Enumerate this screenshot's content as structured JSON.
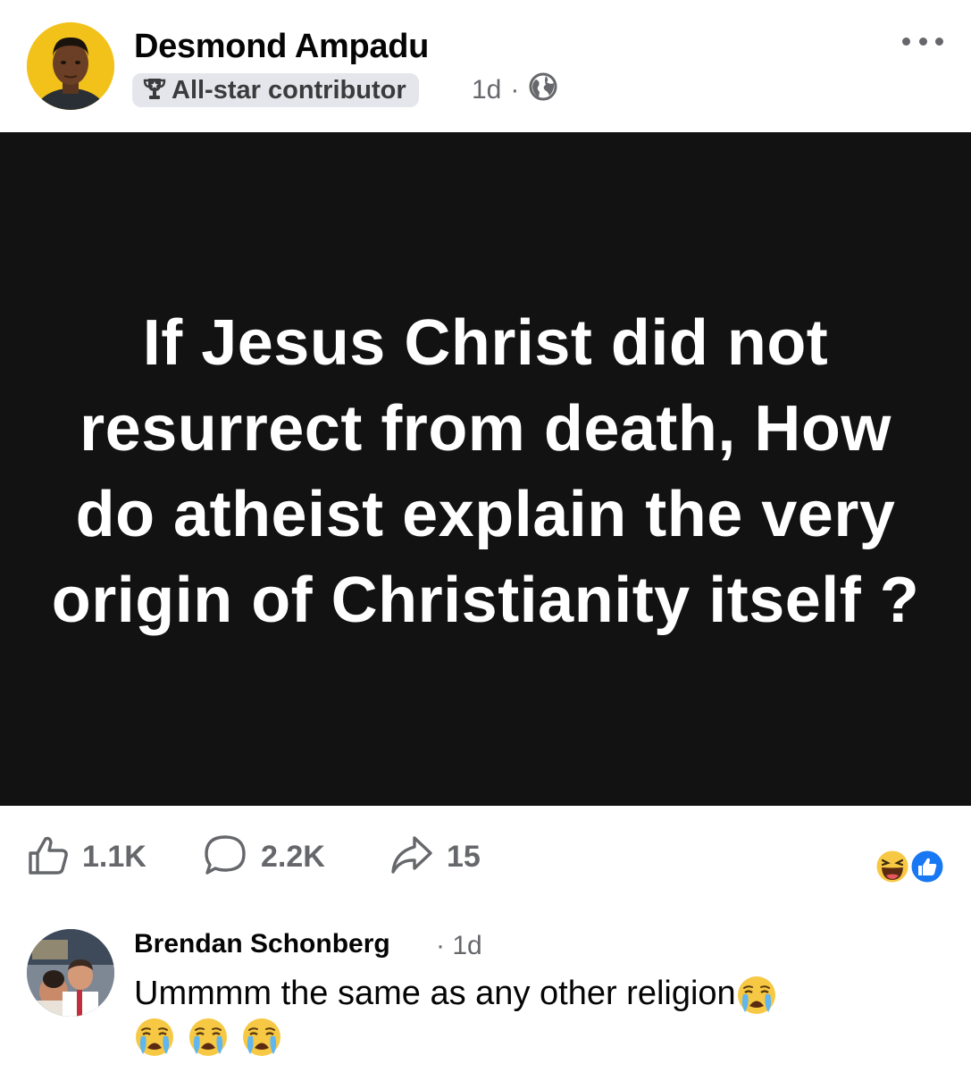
{
  "post": {
    "author": {
      "name": "Desmond Ampadu",
      "badge_icon": "trophy-icon",
      "badge_label": "All-star contributor",
      "time": "1d",
      "separator": "·",
      "audience_icon": "globe-icon",
      "avatar_bg": "#f2c21a"
    },
    "image_text": "If Jesus Christ did not resurrect from death, How do atheist explain the very origin of Christianity itself ?",
    "image_bg": "#121212"
  },
  "actions": {
    "like": {
      "icon": "like-icon",
      "count": "1.1K"
    },
    "comment": {
      "icon": "comment-icon",
      "count": "2.2K"
    },
    "share": {
      "icon": "share-icon",
      "count": "15"
    }
  },
  "reactions": [
    "haha-icon",
    "like-reaction-icon"
  ],
  "comment": {
    "author": "Brendan Schonberg",
    "separator": "·",
    "time": "1d",
    "text": "Ummmm the same as any other religion",
    "emoji": "loudly-crying-face-icon",
    "emoji_count": 4
  },
  "colors": {
    "secondary_text": "#65676b",
    "blue": "#1877f2"
  }
}
